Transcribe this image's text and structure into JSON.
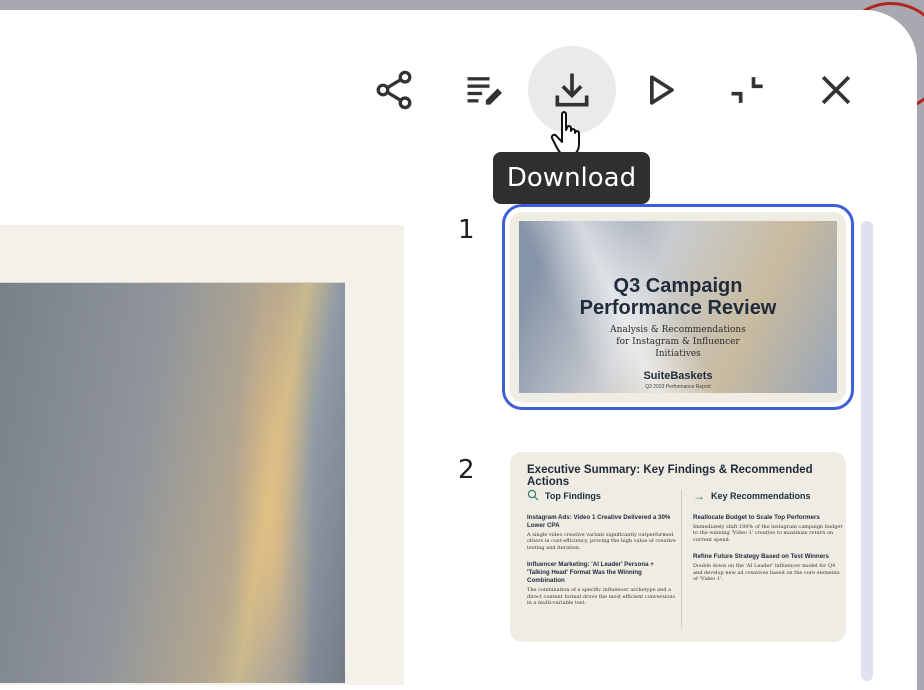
{
  "toolbar": {
    "share_icon": "share-icon",
    "speaker_notes_icon": "speaker-notes-edit-icon",
    "download_icon": "download-icon",
    "present_icon": "play-icon",
    "exit_fullscreen_icon": "exit-fullscreen-icon",
    "close_icon": "close-icon",
    "tooltip": "Download"
  },
  "slides": [
    {
      "number": "1",
      "title": "Q3 Campaign Performance Review",
      "subtitle": "Analysis & Recommendations for Instagram & Influencer Initiatives",
      "brand": "SuiteBaskets",
      "brand_sub": "Q3 2023 Performance Report"
    },
    {
      "number": "2",
      "title": "Executive Summary: Key Findings & Recommended Actions",
      "left_heading": "Top Findings",
      "right_heading": "Key Recommendations",
      "findings": [
        {
          "title": "Instagram Ads: Video 1 Creative Delivered a 30% Lower CPA",
          "body": "A single video creative variant significantly outperformed others in cost-efficiency, proving the high value of creative testing and iteration."
        },
        {
          "title": "Influencer Marketing: 'AI Leader' Persona + 'Talking Head' Format Was the Winning Combination",
          "body": "The combination of a specific influencer archetype and a direct content format drove the most efficient conversions in a multi-variable test."
        }
      ],
      "recommendations": [
        {
          "title": "Reallocate Budget to Scale Top Performers",
          "body": "Immediately shift 100% of the instagram campaign budget to the winning 'Video 1' creative to maximize return on current spend."
        },
        {
          "title": "Refine Future Strategy Based on Test Winners",
          "body": "Double down on the 'AI Leader' influencer model for Q4 and develop new ad creatives based on the core elements of 'Video 1'."
        }
      ]
    }
  ],
  "colors": {
    "selection": "#3f5ed6",
    "tooltip_bg": "#2f2f2f",
    "accent_teal": "#2e7d6b"
  }
}
